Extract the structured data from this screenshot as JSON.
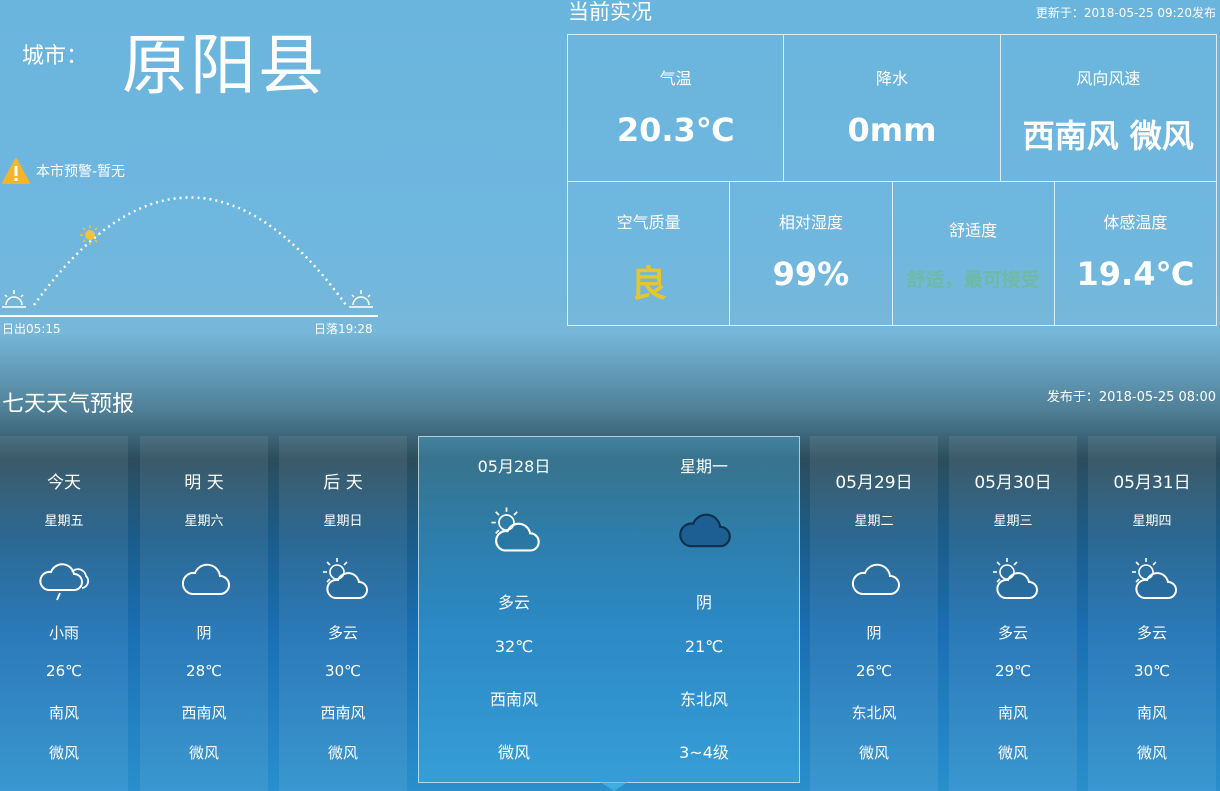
{
  "city": {
    "label": "城市：",
    "name": "原阳县"
  },
  "warning": {
    "text": "本市预警-暂无"
  },
  "sun": {
    "sunrise": "日出05:15",
    "sunset": "日落19:28"
  },
  "current": {
    "title": "当前实况",
    "updated": "更新于：2018-05-25 09:20发布",
    "temperature": {
      "label": "气温",
      "value": "20.3℃"
    },
    "precipitation": {
      "label": "降水",
      "value": "0mm"
    },
    "wind": {
      "label": "风向风速",
      "value": "西南风 微风"
    },
    "air_quality": {
      "label": "空气质量",
      "value": "良",
      "color": "#e7c62c"
    },
    "humidity": {
      "label": "相对湿度",
      "value": "99%"
    },
    "comfort": {
      "label": "舒适度",
      "value": "舒适，最可接受",
      "color": "#6fb9a6"
    },
    "feels_like": {
      "label": "体感温度",
      "value": "19.4℃"
    }
  },
  "forecast": {
    "title": "七天天气预报",
    "published": "发布于：2018-05-25 08:00",
    "days": [
      {
        "name": "今天",
        "weekday": "星期五",
        "icon": "light-rain-icon",
        "weather": "小雨",
        "temp": "26℃",
        "wind_dir": "南风",
        "wind_level": "微风"
      },
      {
        "name": "明 天",
        "weekday": "星期六",
        "icon": "overcast-icon",
        "weather": "阴",
        "temp": "28℃",
        "wind_dir": "西南风",
        "wind_level": "微风"
      },
      {
        "name": "后 天",
        "weekday": "星期日",
        "icon": "partly-cloudy-icon",
        "weather": "多云",
        "temp": "30℃",
        "wind_dir": "西南风",
        "wind_level": "微风"
      },
      {
        "name": "05月29日",
        "weekday": "星期二",
        "icon": "overcast-icon",
        "weather": "阴",
        "temp": "26℃",
        "wind_dir": "东北风",
        "wind_level": "微风"
      },
      {
        "name": "05月30日",
        "weekday": "星期三",
        "icon": "partly-cloudy-icon",
        "weather": "多云",
        "temp": "29℃",
        "wind_dir": "南风",
        "wind_level": "微风"
      },
      {
        "name": "05月31日",
        "weekday": "星期四",
        "icon": "partly-cloudy-icon",
        "weather": "多云",
        "temp": "30℃",
        "wind_dir": "南风",
        "wind_level": "微风"
      }
    ],
    "highlight": {
      "day": {
        "label": "05月28日",
        "icon": "partly-cloudy-icon",
        "weather": "多云",
        "temp": "32℃",
        "wind_dir": "西南风",
        "wind_level": "微风"
      },
      "night": {
        "label": "星期一",
        "icon": "overcast-night-icon",
        "weather": "阴",
        "temp": "21℃",
        "wind_dir": "东北风",
        "wind_level": "3~4级"
      }
    }
  }
}
